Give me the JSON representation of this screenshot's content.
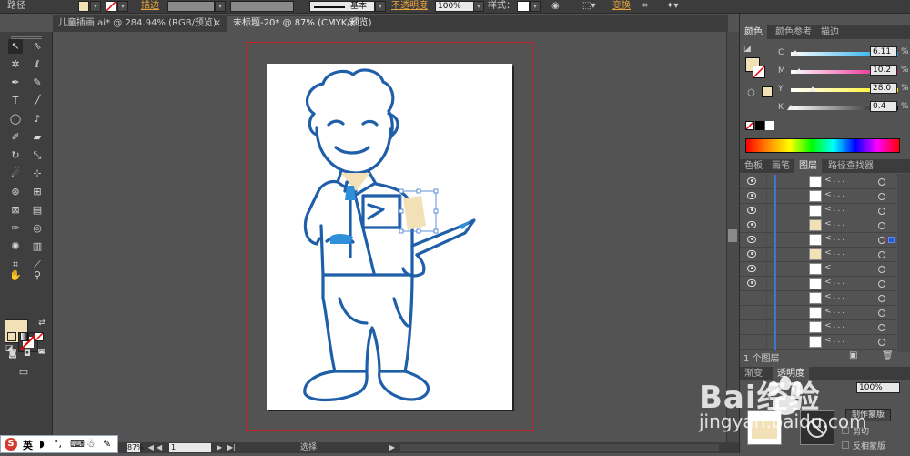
{
  "control_bar": {
    "path_label": "路径",
    "stroke_label": "描边",
    "stroke_style": "基本",
    "opacity_label": "不透明度",
    "opacity_value": "100%",
    "style_label": "样式：",
    "transform_label": "变换"
  },
  "tabs": [
    {
      "label": "儿童插画.ai* @ 284.94% (RGB/预览)"
    },
    {
      "label": "未标题-20* @ 87% (CMYK/预览)"
    }
  ],
  "status_bar": {
    "zoom": "87%",
    "artboard_no": "1",
    "tool_status": "选择"
  },
  "color_panel": {
    "tabs": [
      "颜色",
      "颜色参考",
      "描边"
    ],
    "fill_color": "#f2e1b6",
    "channels": [
      {
        "name": "C",
        "value": "6.11",
        "unit": "%",
        "level": 6.11
      },
      {
        "name": "M",
        "value": "10.2",
        "unit": "%",
        "level": 10.2
      },
      {
        "name": "Y",
        "value": "28.0",
        "unit": "%",
        "level": 28.0
      },
      {
        "name": "K",
        "value": "0.4",
        "unit": "%",
        "level": 0.4
      }
    ]
  },
  "layers_panel": {
    "tabs": [
      "色板",
      "画笔",
      "图层",
      "路径查找器"
    ],
    "layer_name_placeholder": "<...",
    "layer_count_text": "1 个图层",
    "layer_rows": 12
  },
  "transparency_panel": {
    "tabs": [
      "渐变",
      "透明度"
    ],
    "opacity_value": "100%",
    "make_mask_button": "制作蒙版",
    "clip_label": "剪切",
    "invert_mask_label": "反相蒙版"
  },
  "watermark": {
    "brand": "Bai经验",
    "url": "jingyan.baidu.com"
  },
  "taskbar": {
    "ime": "英"
  },
  "colors": {
    "accent_blue": "#1f5ea8",
    "fill_swatch": "#f2e1b6",
    "selection": "#3f74d1"
  }
}
